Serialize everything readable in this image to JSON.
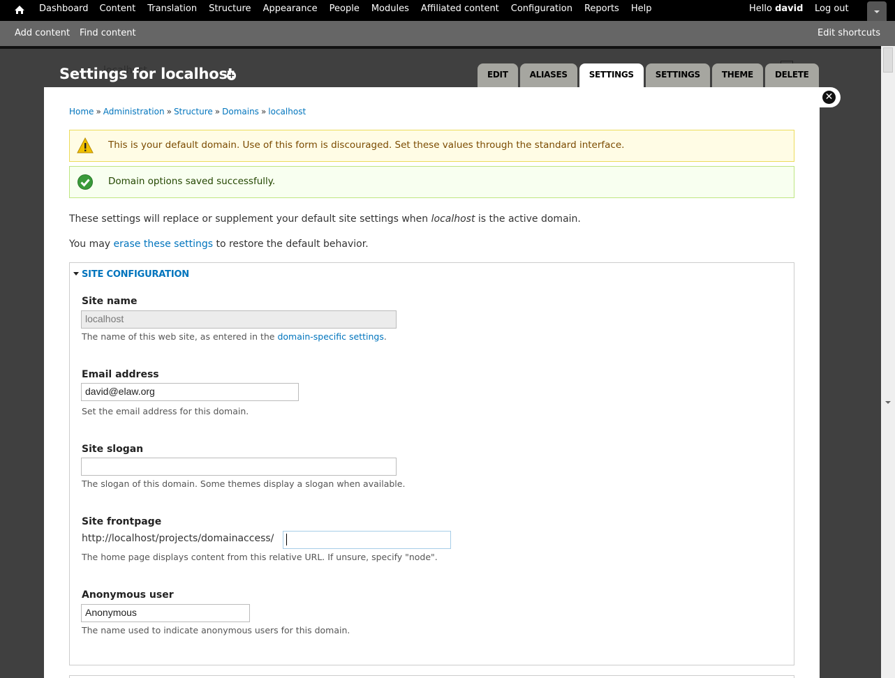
{
  "toolbar": {
    "home_icon": "home-icon",
    "menu": [
      "Dashboard",
      "Content",
      "Translation",
      "Structure",
      "Appearance",
      "People",
      "Modules",
      "Affiliated content",
      "Configuration",
      "Reports",
      "Help"
    ],
    "greeting": "Hello",
    "username": "david",
    "logout": "Log out",
    "toggle_icon": "chevron-down-icon"
  },
  "shortcuts": {
    "items": [
      "Add content",
      "Find content"
    ],
    "edit": "Edit shortcuts"
  },
  "background": {
    "ghost_text": "localhost"
  },
  "page": {
    "title": "Settings for localhost",
    "add_shortcut_icon": "plus-circle-icon"
  },
  "tabs": [
    {
      "label": "EDIT",
      "active": false
    },
    {
      "label": "ALIASES",
      "active": false
    },
    {
      "label": "SETTINGS",
      "active": true
    },
    {
      "label": "SETTINGS",
      "active": false
    },
    {
      "label": "THEME",
      "active": false
    },
    {
      "label": "DELETE",
      "active": false
    }
  ],
  "modal": {
    "close_icon": "close-icon",
    "breadcrumb": [
      "Home",
      "Administration",
      "Structure",
      "Domains",
      "localhost"
    ],
    "breadcrumb_separator": "»",
    "messages": {
      "warning": "This is your default domain. Use of this form is discouraged. Set these values through the standard interface.",
      "status": "Domain options saved successfully."
    },
    "intro": {
      "before": "These settings will replace or supplement your default site settings when ",
      "domain": "localhost",
      "after": " is the active domain."
    },
    "erase": {
      "before": "You may ",
      "link": "erase these settings",
      "after": " to restore the default behavior."
    },
    "fieldset": {
      "legend": "SITE CONFIGURATION",
      "fields": {
        "site_name": {
          "label": "Site name",
          "value": "localhost",
          "desc_before": "The name of this web site, as entered in the ",
          "desc_link": "domain-specific settings",
          "desc_after": "."
        },
        "email": {
          "label": "Email address",
          "value": "david@elaw.org",
          "desc": "Set the email address for this domain."
        },
        "slogan": {
          "label": "Site slogan",
          "value": "",
          "desc": "The slogan of this domain. Some themes display a slogan when available."
        },
        "frontpage": {
          "label": "Site frontpage",
          "prefix": "http://localhost/projects/domainaccess/",
          "value": "",
          "desc": "The home page displays content from this relative URL. If unsure, specify \"node\"."
        },
        "anonymous": {
          "label": "Anonymous user",
          "value": "Anonymous",
          "desc": "The name used to indicate anonymous users for this domain."
        }
      }
    }
  }
}
